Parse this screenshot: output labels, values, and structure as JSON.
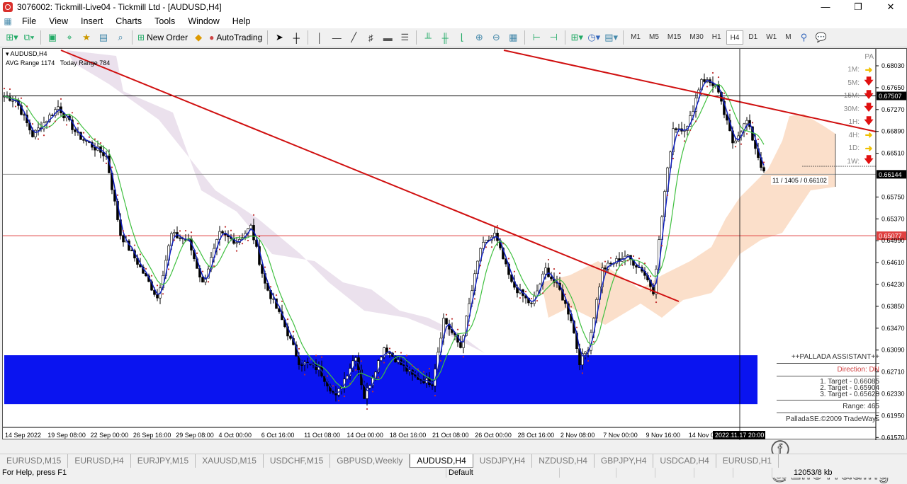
{
  "window": {
    "title": "3076002: Tickmill-Live04 - Tickmill Ltd - [AUDUSD,H4]",
    "min": "—",
    "restore": "❐",
    "close": "✕"
  },
  "menu": [
    "File",
    "View",
    "Insert",
    "Charts",
    "Tools",
    "Window",
    "Help"
  ],
  "toolbar": {
    "new_order": "New Order",
    "autotrading": "AutoTrading",
    "timeframes": [
      "M1",
      "M5",
      "M15",
      "M30",
      "H1",
      "H4",
      "D1",
      "W1",
      "M"
    ],
    "active_tf": "H4"
  },
  "chart": {
    "symbol": "AUDUSD,H4",
    "avg_range": "AVG Range 1174",
    "today_range": "Today Range 784",
    "price_labels": [
      "0.68030",
      "0.67650",
      "0.67270",
      "0.66890",
      "0.66510",
      "0.65750",
      "0.65370",
      "0.64990",
      "0.64610",
      "0.64230",
      "0.63850",
      "0.63470",
      "0.63090",
      "0.62710",
      "0.62330",
      "0.61950",
      "0.61570"
    ],
    "price_min": 0.6135,
    "price_max": 0.684,
    "markers": [
      {
        "value": "0.67507",
        "price": 0.67507,
        "color": "#000000"
      },
      {
        "value": "0.66144",
        "price": 0.66144,
        "color": "#999999"
      },
      {
        "value": "0.65077",
        "price": 0.65077,
        "color": "#e04040"
      }
    ],
    "date_labels": [
      "14 Sep 2022",
      "19 Sep 08:00",
      "22 Sep 00:00",
      "26 Sep 16:00",
      "29 Sep 08:00",
      "4 Oct 00:00",
      "6 Oct 16:00",
      "11 Oct 08:00",
      "14 Oct 00:00",
      "18 Oct 16:00",
      "21 Oct 08:00",
      "26 Oct 00:00",
      "28 Oct 16:00",
      "2 Nov 08:00",
      "7 Nov 00:00",
      "9 Nov 16:00",
      "14 Nov 08:00"
    ],
    "crosshair_date": "2022.11.17 20:00",
    "support_zone": {
      "low": 0.6215,
      "high": 0.63,
      "color": "#0a14f0"
    },
    "close_waypoints": [
      [
        0,
        0.675
      ],
      [
        4,
        0.6744
      ],
      [
        10,
        0.6682
      ],
      [
        19,
        0.6732
      ],
      [
        26,
        0.6682
      ],
      [
        36,
        0.6646
      ],
      [
        41,
        0.651
      ],
      [
        47,
        0.6461
      ],
      [
        54,
        0.64
      ],
      [
        59,
        0.651
      ],
      [
        65,
        0.6498
      ],
      [
        70,
        0.6424
      ],
      [
        76,
        0.651
      ],
      [
        82,
        0.6498
      ],
      [
        87,
        0.6523
      ],
      [
        92,
        0.6424
      ],
      [
        99,
        0.635
      ],
      [
        104,
        0.6289
      ],
      [
        111,
        0.6276
      ],
      [
        117,
        0.6227
      ],
      [
        124,
        0.6301
      ],
      [
        127,
        0.6227
      ],
      [
        134,
        0.6314
      ],
      [
        144,
        0.6264
      ],
      [
        151,
        0.6252
      ],
      [
        155,
        0.6363
      ],
      [
        161,
        0.6314
      ],
      [
        168,
        0.6486
      ],
      [
        173,
        0.651
      ],
      [
        179,
        0.6424
      ],
      [
        186,
        0.6387
      ],
      [
        191,
        0.6449
      ],
      [
        196,
        0.6412
      ],
      [
        200,
        0.6363
      ],
      [
        203,
        0.6289
      ],
      [
        206,
        0.6314
      ],
      [
        211,
        0.6449
      ],
      [
        219,
        0.6473
      ],
      [
        225,
        0.6449
      ],
      [
        229,
        0.6412
      ],
      [
        233,
        0.6584
      ],
      [
        236,
        0.6695
      ],
      [
        241,
        0.6695
      ],
      [
        246,
        0.6781
      ],
      [
        251,
        0.6769
      ],
      [
        257,
        0.667
      ],
      [
        262,
        0.6707
      ],
      [
        268,
        0.6615
      ]
    ],
    "last_bar_info": "11 / 1405 / 0.66102"
  },
  "pa_panel": {
    "title": "PA",
    "rows": [
      {
        "tf": "1M:",
        "dir": "right"
      },
      {
        "tf": "5M:",
        "dir": "down"
      },
      {
        "tf": "15M:",
        "dir": "down"
      },
      {
        "tf": "30M:",
        "dir": "down"
      },
      {
        "tf": "1H:",
        "dir": "down"
      },
      {
        "tf": "4H:",
        "dir": "right"
      },
      {
        "tf": "1D:",
        "dir": "right"
      },
      {
        "tf": "1W:",
        "dir": "down"
      }
    ]
  },
  "assistant": {
    "title": "++PALLADA ASSISTANT++",
    "direction": "Direction: DN",
    "targets": [
      "1. Target - 0.66085",
      "2. Target - 0.65904",
      "3. Target - 0.65620"
    ],
    "range": "Range: 465",
    "footer": "PalladaSE.©2009 TradeWays"
  },
  "tabs": [
    "EURUSD,M15",
    "EURUSD,H4",
    "EURJPY,M15",
    "XAUUSD,M15",
    "USDCHF,M15",
    "GBPUSD,Weekly",
    "AUDUSD,H4",
    "USDJPY,H4",
    "NZDUSD,H4",
    "GBPJPY,H4",
    "USDCAD,H4",
    "EURUSD,H1"
  ],
  "active_tab": "AUDUSD,H4",
  "status": {
    "help": "For Help, press F1",
    "profile": "Default",
    "traffic": "12053/8 kb"
  },
  "watermark": "ⓕ @LifeTrading"
}
